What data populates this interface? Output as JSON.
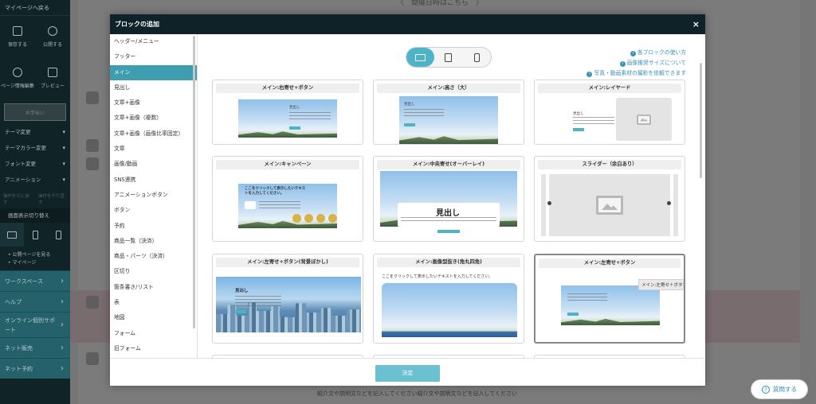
{
  "sidebar": {
    "back_label": "マイページへ戻る",
    "tools": [
      {
        "label": "保存する",
        "icon": "save-icon"
      },
      {
        "label": "公開する",
        "icon": "globe-icon"
      },
      {
        "label": "ページ情報編集",
        "icon": "gear-icon"
      },
      {
        "label": "プレビュー",
        "icon": "preview-icon"
      }
    ],
    "preview_btn": "お手伝い",
    "menu": [
      "テーマ変更",
      "テーマカラー変更",
      "フォント変更",
      "アニメーション"
    ],
    "grey_tools": [
      "操作を元に戻す",
      "操作をやり直す"
    ],
    "screen_switch_label": "画面表示切り替え",
    "links": [
      "公開ページを見る",
      "マイページ"
    ],
    "teal_menu": [
      {
        "label": "ワークスペース",
        "tall": false
      },
      {
        "label": "ヘルプ",
        "tall": false
      },
      {
        "label": "オンライン個別サポート",
        "tall": true
      },
      {
        "label": "ネット販売",
        "tall": false
      },
      {
        "label": "ネット予約",
        "tall": false
      }
    ]
  },
  "canvas": {
    "heading": "〈　開催日時はこちら　〉",
    "bottom_text": "紹介文や説明文などを記入してください紹介文や説明文などを記入してください"
  },
  "modal": {
    "title": "ブロックの追加",
    "close_label": "×",
    "categories": [
      "ヘッダー/メニュー",
      "フッター",
      "メイン",
      "見出し",
      "文章+画像",
      "文章+画像（複数）",
      "文章+画像（画像比率固定）",
      "文章",
      "画像/動画",
      "SNS連携",
      "アニメーションボタン",
      "ボタン",
      "予約",
      "商品一覧（決済）",
      "商品・パーツ（決済）",
      "区切り",
      "箇条書き/リスト",
      "表",
      "地図",
      "フォーム",
      "旧フォーム"
    ],
    "active_category": 2,
    "help_links": [
      "各ブロックの使い方",
      "画像推奨サイズについて",
      "写真・動画素材の撮影を依頼できます"
    ],
    "cards": [
      {
        "title": "メイン:右寄せ+ボタン"
      },
      {
        "title": "メイン:高さ（大）"
      },
      {
        "title": "メイン:レイヤード"
      },
      {
        "title": "メイン:キャンペーン"
      },
      {
        "title": "メイン:中央寄せ(オーバーレイ)"
      },
      {
        "title": "スライダー（余白あり）"
      },
      {
        "title": "メイン:左寄せ+ボタン(背景ぼかし)"
      },
      {
        "title": "メイン:画像型抜き(角丸四角)"
      },
      {
        "title": "メイン:左寄せ+ボタン"
      }
    ],
    "thumb": {
      "heading": "見出し",
      "click_hint": "ここをクリックして表示したいテキストを入力してください。",
      "campaign_text": "ここをクリックして表示したいテキストを入力してください。"
    },
    "tooltip": "メイン:左寄せ＋ボタン",
    "decide_label": "決定"
  },
  "question_button": "質問する",
  "colors": {
    "accent": "#4fb3c8",
    "header": "#0f2227",
    "link": "#3a92b8",
    "active_category": "#3f9db0"
  }
}
